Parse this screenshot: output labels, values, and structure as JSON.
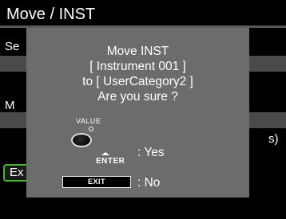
{
  "screen": {
    "title": "Move / INST",
    "bg_label_1": "Se",
    "bg_label_2": "M",
    "bg_label_3": "s)",
    "bg_button": "Ex"
  },
  "dialog": {
    "line1": "Move INST",
    "line2": "[ Instrument 001 ]",
    "line3": "to [ UserCategory2 ]",
    "line4": "Are you sure ?",
    "value_label": "VALUE",
    "enter_label": "ENTER",
    "yes_text": ": Yes",
    "exit_key_label": "EXIT",
    "no_text": ": No"
  },
  "colors": {
    "accent_green": "#44b62a",
    "dialog_bg": "#6c6c6c"
  },
  "icons": [
    "value-knob-icon",
    "enter-arrow-icon"
  ]
}
